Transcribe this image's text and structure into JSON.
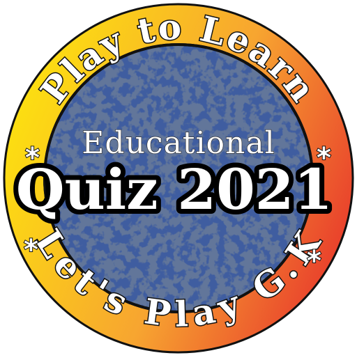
{
  "badge": {
    "top_arc_text": "Play to Learn",
    "bottom_arc_text": "Let's Play G.K",
    "subtitle": "Educational",
    "title": "Quiz 2021",
    "star_glyph": "*"
  },
  "colors": {
    "ring_gradient_start": "#fde20f",
    "ring_gradient_mid": "#f7a530",
    "ring_gradient_end": "#e83a2c",
    "center_fill": "#3f5da0",
    "center_speckle": "#1e2e4f",
    "outline": "#111111",
    "text_fill": "#ffffff"
  }
}
